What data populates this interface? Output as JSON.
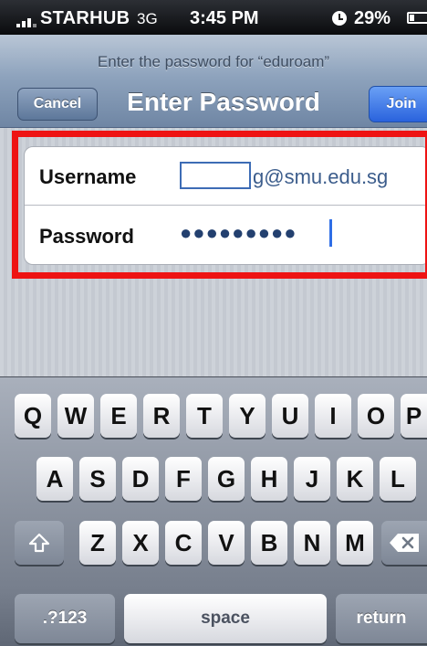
{
  "status_bar": {
    "carrier": "STARHUB",
    "network": "3G",
    "time": "3:45 PM",
    "battery": "29%"
  },
  "prompt": "Enter the password for “eduroam”",
  "nav": {
    "title": "Enter Password",
    "cancel_label": "Cancel",
    "join_label": "Join"
  },
  "form": {
    "username_label": "Username",
    "username_value": "g@smu.edu.sg",
    "password_label": "Password",
    "password_value": "●●●●●●●●●"
  },
  "keyboard": {
    "row1": [
      "Q",
      "W",
      "E",
      "R",
      "T",
      "Y",
      "U",
      "I",
      "O",
      "P"
    ],
    "row2": [
      "A",
      "S",
      "D",
      "F",
      "G",
      "H",
      "J",
      "K",
      "L"
    ],
    "row3": [
      "Z",
      "X",
      "C",
      "V",
      "B",
      "N",
      "M"
    ],
    "numbers_label": ".?123",
    "space_label": "space",
    "return_label": "return"
  },
  "colors": {
    "highlight_border": "#ee1313",
    "join_button": "#2a63dd",
    "cursor": "#2f6ee6"
  },
  "icons": [
    "signal-icon",
    "alarm-icon",
    "battery-icon",
    "shift-icon",
    "backspace-icon"
  ]
}
